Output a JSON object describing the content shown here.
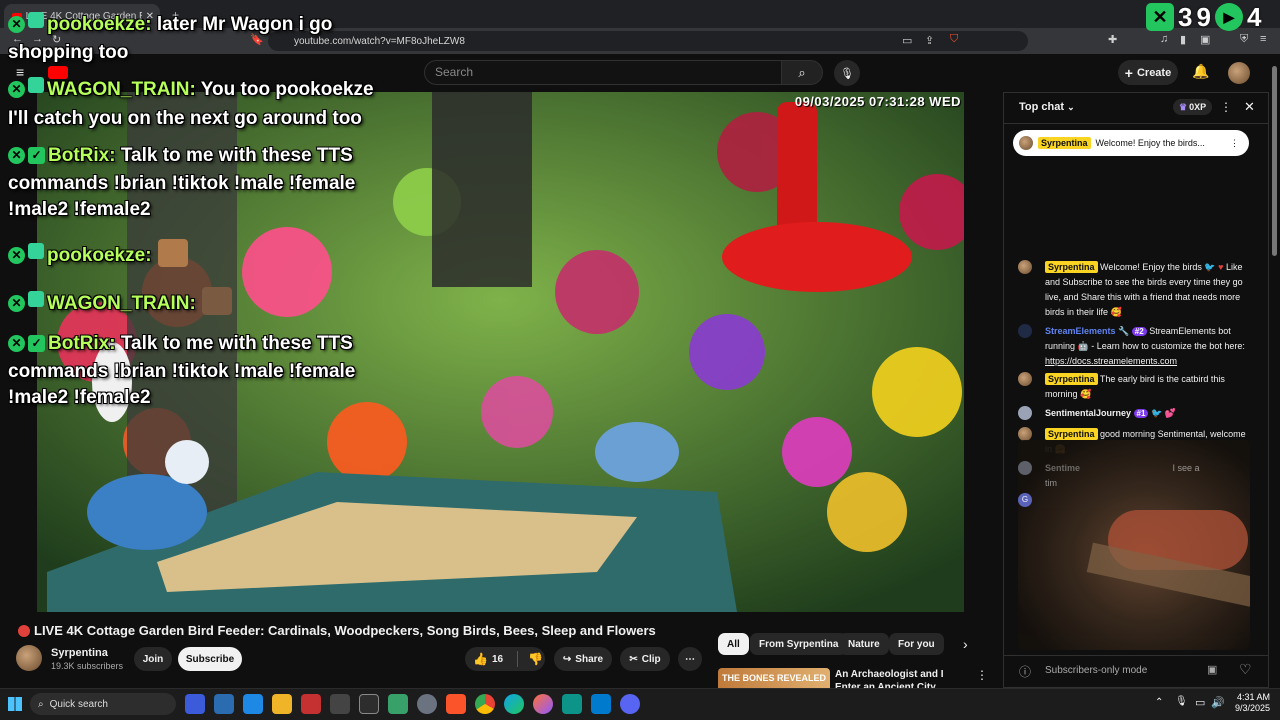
{
  "browser": {
    "tab_title": "LIVE 4K Cottage Garden B",
    "url": "youtube.com/watch?v=MF8oJheLZW8"
  },
  "youtube": {
    "search_placeholder": "Search",
    "create_label": "Create"
  },
  "video": {
    "timestamp": "09/03/2025 07:31:28 WED",
    "title": "LIVE 4K Cottage Garden Bird Feeder: Cardinals, Woodpeckers, Song Birds, Bees, Sleep and Flowers",
    "channel": "Syrpentina",
    "subscribers": "19.3K subscribers",
    "join_label": "Join",
    "subscribe_label": "Subscribe",
    "likes": "16",
    "share_label": "Share",
    "clip_label": "Clip"
  },
  "overlay_counter": {
    "a": "3",
    "b": "9",
    "c": "4"
  },
  "overlay_chat": [
    {
      "user": "pookoekze:",
      "text": "later Mr Wagon i go",
      "text2": "shopping too"
    },
    {
      "user": "WAGON_TRAIN:",
      "text": "You too pookoekze",
      "text2": "I'll catch you on the next go around too"
    },
    {
      "user": "BotRix:",
      "text": "Talk to me with these TTS",
      "text2": "commands !brian !tiktok !male !female",
      "text3": "!male2 !female2"
    },
    {
      "user": "pookoekze:"
    },
    {
      "user": "WAGON_TRAIN:"
    },
    {
      "user": "BotRix:",
      "text": "Talk to me with these TTS",
      "text2": "commands !brian !tiktok !male !female",
      "text3": "!male2 !female2"
    }
  ],
  "chips": [
    "All",
    "From Syrpentina",
    "Nature",
    "For you"
  ],
  "recommendation": {
    "thumb_text": "THE BONES REVEALED",
    "title": "An Archaeologist and I Enter an Ancient City Eroding Out of th..."
  },
  "chat": {
    "header": "Top chat",
    "points": "0XP",
    "pinned_author": "Syrpentina",
    "pinned_text": "Welcome! Enjoy the birds...",
    "messages": [
      {
        "author": "Syrpentina",
        "text": "Welcome! Enjoy the birds",
        "text2": "Like and Subscribe to see the birds every time they go live, and Share this with a friend that needs more birds in their life"
      },
      {
        "author": "StreamElements",
        "badge": "#2",
        "text": "StreamElements bot running",
        "text2": "- Learn how to customize the bot here:",
        "link": "https://docs.streamelements.com"
      },
      {
        "author": "Syrpentina",
        "text": "The early bird is the catbird this morning"
      },
      {
        "author": "SentimentalJourney",
        "badge": "#1"
      },
      {
        "author": "Syrpentina",
        "text": "good morning Sentimental, welcome in"
      },
      {
        "author": "Sentime",
        "text": "I see a",
        "text2": "tim"
      }
    ],
    "input_placeholder": "Subscribers-only mode"
  },
  "taskbar": {
    "search_label": "Quick search",
    "time": "4:31 AM",
    "date": "9/3/2025"
  }
}
